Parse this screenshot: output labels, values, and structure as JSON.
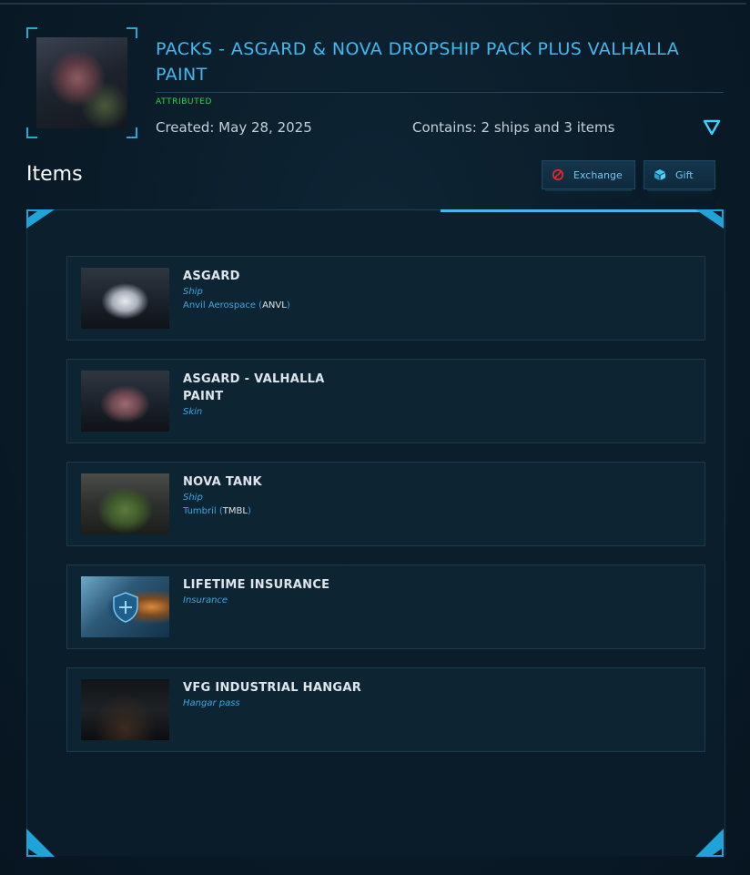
{
  "pack": {
    "title": "PACKS - ASGARD & NOVA DROPSHIP PACK PLUS VALHALLA PAINT",
    "status": "ATTRIBUTED",
    "created": "Created: May 28, 2025",
    "contains": "Contains: 2 ships and 3 items",
    "status_color": "#2bd64a",
    "accent_color": "#41b8ee"
  },
  "items_section": {
    "heading": "Items",
    "exchange_label": "Exchange",
    "gift_label": "Gift",
    "exchange_icon": "prohibited-icon",
    "gift_icon": "gift-icon"
  },
  "items": [
    {
      "name": "ASGARD",
      "type": "Ship",
      "maker": "Anvil Aerospace",
      "maker_code": "ANVL",
      "thumb": "asgard-thumbnail"
    },
    {
      "name": "ASGARD - VALHALLA PAINT",
      "type": "Skin",
      "thumb": "valhalla-paint-thumbnail"
    },
    {
      "name": "NOVA TANK",
      "type": "Ship",
      "maker": "Tumbril",
      "maker_code": "TMBL",
      "thumb": "nova-tank-thumbnail"
    },
    {
      "name": "LIFETIME INSURANCE",
      "type": "Insurance",
      "thumb": "insurance-thumbnail"
    },
    {
      "name": "VFG INDUSTRIAL HANGAR",
      "type": "Hangar pass",
      "thumb": "hangar-thumbnail"
    }
  ]
}
